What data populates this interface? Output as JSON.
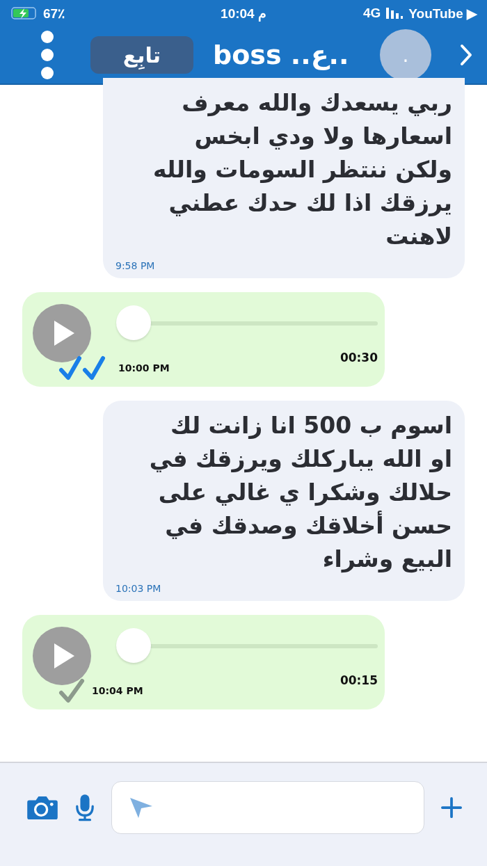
{
  "status_bar": {
    "battery": "67٪",
    "time": "10:04 م",
    "network": "4G",
    "carrier": "YouTube ▶"
  },
  "header": {
    "follow_button": "تابِع",
    "title": "..ع.. boss",
    "avatar": "."
  },
  "messages": [
    {
      "kind": "text",
      "text": "ربي يسعدك والله معرف\nاسعارها ولا ودي ابخس\nولكن ننتظر السومات والله\nيرزقك اذا لك حدك عطني\nلاهنت",
      "time": "9:58 PM"
    },
    {
      "kind": "voice",
      "duration": "00:30",
      "time": "10:00 PM",
      "read": true,
      "level": 0
    },
    {
      "kind": "text",
      "text": "اسوم ب 500  انا زانت لك\nاو الله يباركلك ويرزقك في\nحلالك وشكرا ي غالي على\nحسن أخلاقك وصدقك في\nالبيع وشراء",
      "time": "10:03 PM"
    },
    {
      "kind": "voice",
      "duration": "00:15",
      "time": "10:04 PM",
      "read": false,
      "level": 0
    }
  ]
}
